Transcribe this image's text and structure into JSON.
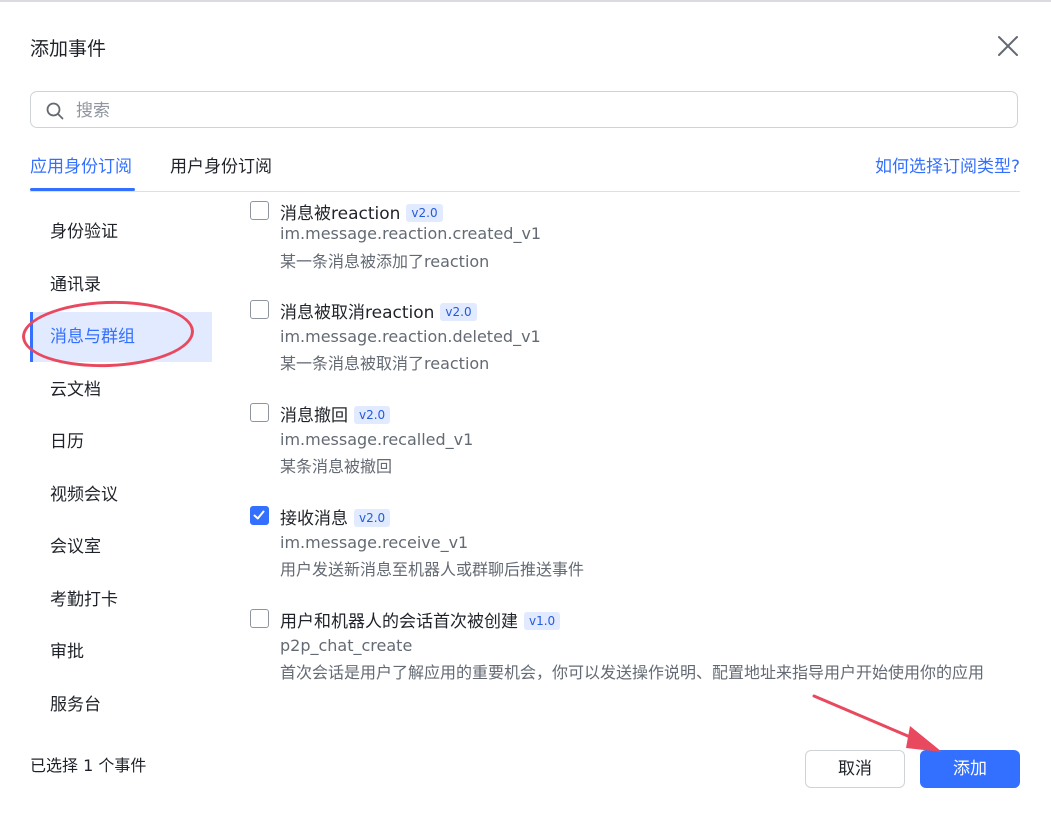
{
  "dialog": {
    "title": "添加事件"
  },
  "search": {
    "placeholder": "搜索",
    "value": ""
  },
  "tabs": [
    {
      "label": "应用身份订阅",
      "active": true
    },
    {
      "label": "用户身份订阅",
      "active": false
    }
  ],
  "help_link": "如何选择订阅类型?",
  "sidebar": {
    "items": [
      {
        "label": "身份验证",
        "active": false
      },
      {
        "label": "通讯录",
        "active": false
      },
      {
        "label": "消息与群组",
        "active": true
      },
      {
        "label": "云文档",
        "active": false
      },
      {
        "label": "日历",
        "active": false
      },
      {
        "label": "视频会议",
        "active": false
      },
      {
        "label": "会议室",
        "active": false
      },
      {
        "label": "考勤打卡",
        "active": false
      },
      {
        "label": "审批",
        "active": false
      },
      {
        "label": "服务台",
        "active": false
      }
    ]
  },
  "events": [
    {
      "name": "消息被reaction",
      "version": "v2.0",
      "key": "im.message.reaction.created_v1",
      "desc": "某一条消息被添加了reaction",
      "checked": false
    },
    {
      "name": "消息被取消reaction",
      "version": "v2.0",
      "key": "im.message.reaction.deleted_v1",
      "desc": "某一条消息被取消了reaction",
      "checked": false
    },
    {
      "name": "消息撤回",
      "version": "v2.0",
      "key": "im.message.recalled_v1",
      "desc": "某条消息被撤回",
      "checked": false
    },
    {
      "name": "接收消息",
      "version": "v2.0",
      "key": "im.message.receive_v1",
      "desc": "用户发送新消息至机器人或群聊后推送事件",
      "checked": true
    },
    {
      "name": "用户和机器人的会话首次被创建",
      "version": "v1.0",
      "key": "p2p_chat_create",
      "desc": "首次会话是用户了解应用的重要机会，你可以发送操作说明、配置地址来指导用户开始使用你的应用",
      "checked": false
    }
  ],
  "footer": {
    "selected_count": "已选择 1 个事件",
    "cancel_label": "取消",
    "add_label": "添加"
  },
  "colors": {
    "accent": "#3370ff",
    "annotation": "#e9495e"
  }
}
